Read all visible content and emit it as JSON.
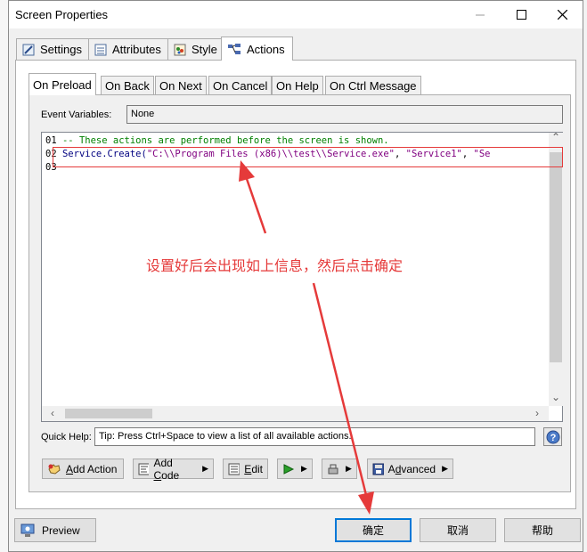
{
  "window": {
    "title": "Screen Properties"
  },
  "outer_tabs": [
    {
      "label": "Settings",
      "icon": "pencil-icon"
    },
    {
      "label": "Attributes",
      "icon": "list-icon"
    },
    {
      "label": "Style",
      "icon": "palette-icon"
    },
    {
      "label": "Actions",
      "icon": "flow-icon",
      "active": true
    }
  ],
  "inner_tabs": [
    "On Preload",
    "On Back",
    "On Next",
    "On Cancel",
    "On Help",
    "On Ctrl Message"
  ],
  "event_variables": {
    "label": "Event Variables:",
    "value": "None"
  },
  "editor": {
    "lines": [
      {
        "num": "01",
        "comment": "-- These actions are performed before the screen is shown."
      },
      {
        "num": "02",
        "func": "Service.Create(",
        "str1": "\"C:\\\\Program Files (x86)\\\\test\\\\Service.exe\"",
        "sep": ", ",
        "str2": "\"Service1\"",
        "sep2": ", ",
        "str3": "\"Se"
      },
      {
        "num": "03"
      }
    ]
  },
  "quick_help": {
    "label": "Quick Help:",
    "value": "Tip: Press Ctrl+Space to view a list of all available actions."
  },
  "toolbar": {
    "add_action_prefix": "A",
    "add_action_rest": "dd Action",
    "add_code_prefix": "Add ",
    "add_code_u": "C",
    "add_code_rest": "ode",
    "edit_u": "E",
    "edit_rest": "dit",
    "advanced_prefix": "A",
    "advanced_u": "d",
    "advanced_rest": "vanced"
  },
  "bottom": {
    "preview": "Preview",
    "ok": "确定",
    "cancel": "取消",
    "help": "帮助"
  },
  "annotation": {
    "text": "设置好后会出现如上信息，然后点击确定",
    "color": "#e53a3a"
  },
  "colors": {
    "accent": "#0078d7",
    "annotation": "#e53a3a",
    "comment": "#008000",
    "string": "#800080"
  }
}
